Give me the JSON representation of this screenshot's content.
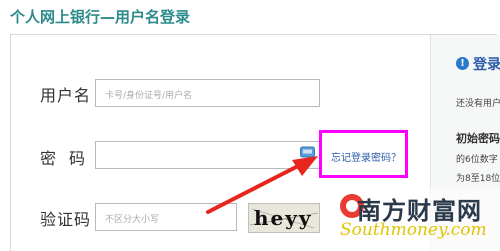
{
  "header": {
    "title": "个人网上银行—用户名登录"
  },
  "form": {
    "username_label": "用户名",
    "username_placeholder": "卡号/身份证号/用户名",
    "password_label": "密码",
    "password_value": "",
    "forgot_link": "忘记登录密码？",
    "captcha_label": "验证码",
    "captcha_placeholder": "不区分大小写",
    "captcha_text": "heyy"
  },
  "right_panel": {
    "title": "登录",
    "line1": "还没有用户",
    "initial_password_title": "初始密码",
    "line2": "的6位数字",
    "line3": "为8至18位"
  },
  "watermark": {
    "chinese": "南方财富网",
    "english": "Southmoney.com"
  },
  "colors": {
    "header": "#2e8b8b",
    "link": "#2a5caa",
    "highlight": "#ff00ff",
    "arrow": "#e8251c"
  }
}
